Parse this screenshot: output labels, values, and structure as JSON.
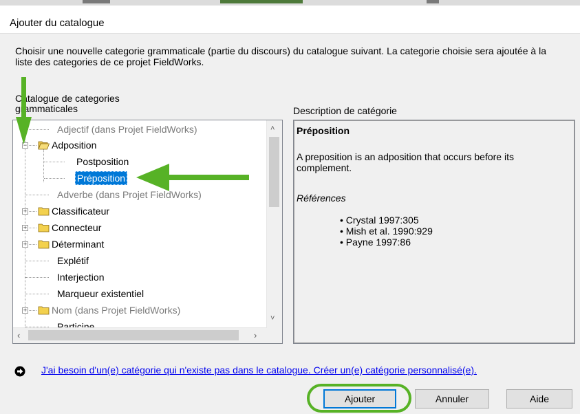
{
  "dialog": {
    "title": "Ajouter du catalogue",
    "instructions": "Choisir une nouvelle categorie grammaticale (partie du discours) du catalogue suivant. La categorie choisie sera ajoutée à la liste des categories de ce projet FieldWorks."
  },
  "tree": {
    "label": "Catalogue de categories grammaticales",
    "items": [
      {
        "label": "Adjectif (dans Projet FieldWorks)"
      },
      {
        "label": "Adposition"
      },
      {
        "label": "Postposition"
      },
      {
        "label": "Préposition"
      },
      {
        "label": "Adverbe (dans Projet FieldWorks)"
      },
      {
        "label": "Classificateur"
      },
      {
        "label": "Connecteur"
      },
      {
        "label": "Déterminant"
      },
      {
        "label": "Explétif"
      },
      {
        "label": "Interjection"
      },
      {
        "label": "Marqueur existentiel"
      },
      {
        "label": "Nom (dans Projet FieldWorks)"
      },
      {
        "label": "Particine"
      }
    ]
  },
  "description": {
    "label": "Description de catégorie",
    "title": "Préposition",
    "text": "A preposition is an adposition that occurs before its complement.",
    "references_heading": "Références",
    "references": [
      "• Crystal 1997:305",
      "• Mish et al. 1990:929",
      "• Payne 1997:86"
    ]
  },
  "link": {
    "text": "J'ai besoin d'un(e) catégorie qui n'existe pas dans le catalogue. Créer un(e) catégorie personnalisé(e)."
  },
  "buttons": {
    "add": "Ajouter",
    "cancel": "Annuler",
    "help": "Aide"
  },
  "colors": {
    "selection": "#0078d7",
    "annotation_green": "#57b226",
    "link": "#0000ee"
  }
}
